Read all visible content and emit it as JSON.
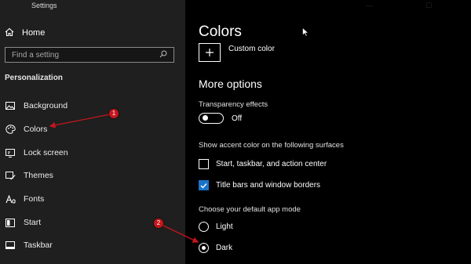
{
  "window": {
    "title": "Settings"
  },
  "sidebar": {
    "home_label": "Home",
    "search_placeholder": "Find a setting",
    "section_label": "Personalization",
    "items": [
      {
        "label": "Background",
        "icon": "image-icon"
      },
      {
        "label": "Colors",
        "icon": "palette-icon"
      },
      {
        "label": "Lock screen",
        "icon": "monitor-icon"
      },
      {
        "label": "Themes",
        "icon": "brush-icon"
      },
      {
        "label": "Fonts",
        "icon": "fonts-icon"
      },
      {
        "label": "Start",
        "icon": "start-icon"
      },
      {
        "label": "Taskbar",
        "icon": "taskbar-icon"
      }
    ]
  },
  "main": {
    "title": "Colors",
    "custom_color_label": "Custom color",
    "more_options_heading": "More options",
    "transparency": {
      "label": "Transparency effects",
      "state_label": "Off",
      "on": false
    },
    "accent_surfaces": {
      "label": "Show accent color on the following surfaces",
      "options": [
        {
          "label": "Start, taskbar, and action center",
          "checked": false
        },
        {
          "label": "Title bars and window borders",
          "checked": true
        }
      ]
    },
    "app_mode": {
      "label": "Choose your default app mode",
      "options": [
        {
          "label": "Light",
          "selected": false
        },
        {
          "label": "Dark",
          "selected": true
        }
      ]
    }
  },
  "annotations": [
    {
      "number": "1",
      "color": "#c4161c"
    },
    {
      "number": "2",
      "color": "#c4161c"
    }
  ],
  "colors": {
    "sidebar_bg": "#1f1f1f",
    "main_bg": "#000000",
    "accent": "#1a73c8",
    "annotation": "#c4161c"
  }
}
